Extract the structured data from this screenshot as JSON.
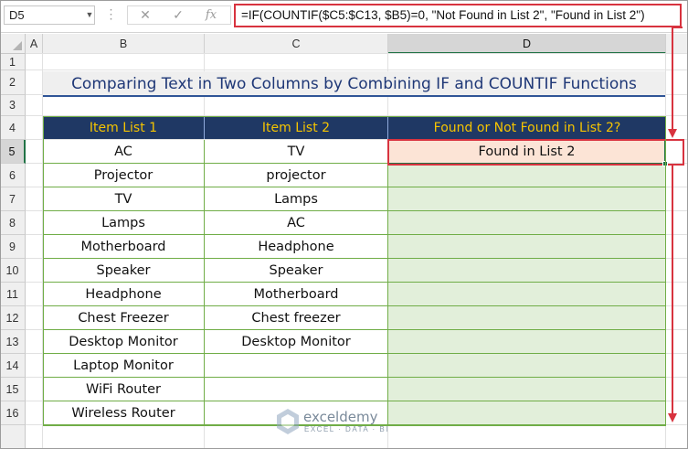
{
  "formula_bar": {
    "name_box": "D5",
    "dots": "⋮",
    "cancel_icon": "✕",
    "enter_icon": "✓",
    "fx_icon": "fx",
    "formula": "=IF(COUNTIF($C5:$C13, $B5)=0, \"Not Found in List 2\", \"Found in List 2\")"
  },
  "columns": [
    "A",
    "B",
    "C",
    "D"
  ],
  "rows": [
    "1",
    "2",
    "3",
    "4",
    "5",
    "6",
    "7",
    "8",
    "9",
    "10",
    "11",
    "12",
    "13",
    "14",
    "15",
    "16"
  ],
  "active_cell": {
    "column": "D",
    "row": "5"
  },
  "title": "Comparing Text in Two Columns by Combining IF and COUNTIF Functions",
  "table": {
    "headers": [
      "Item List 1",
      "Item List 2",
      "Found or Not Found in List 2?"
    ],
    "list1": [
      "AC",
      "Projector",
      "TV",
      "Lamps",
      "Motherboard",
      "Speaker",
      "Headphone",
      "Chest Freezer",
      "Desktop Monitor",
      "Laptop Monitor",
      "WiFi Router",
      "Wireless Router"
    ],
    "list2": [
      "TV",
      "projector",
      "Lamps",
      "AC",
      "Headphone",
      "Speaker",
      "Motherboard",
      "Chest freezer",
      "Desktop Monitor",
      "",
      "",
      ""
    ],
    "result": [
      "Found in List 2",
      "",
      "",
      "",
      "",
      "",
      "",
      "",
      "",
      "",
      "",
      ""
    ]
  },
  "watermark": {
    "name": "exceldemy",
    "tagline": "EXCEL · DATA · BI"
  },
  "colors": {
    "header_bg": "#1f3864",
    "header_text": "#f5c400",
    "title_text": "#1f3877",
    "result_highlight": "#fce4d6",
    "result_fill": "#e2efda",
    "border_green": "#70ad47",
    "annotation_red": "#d8333f"
  }
}
